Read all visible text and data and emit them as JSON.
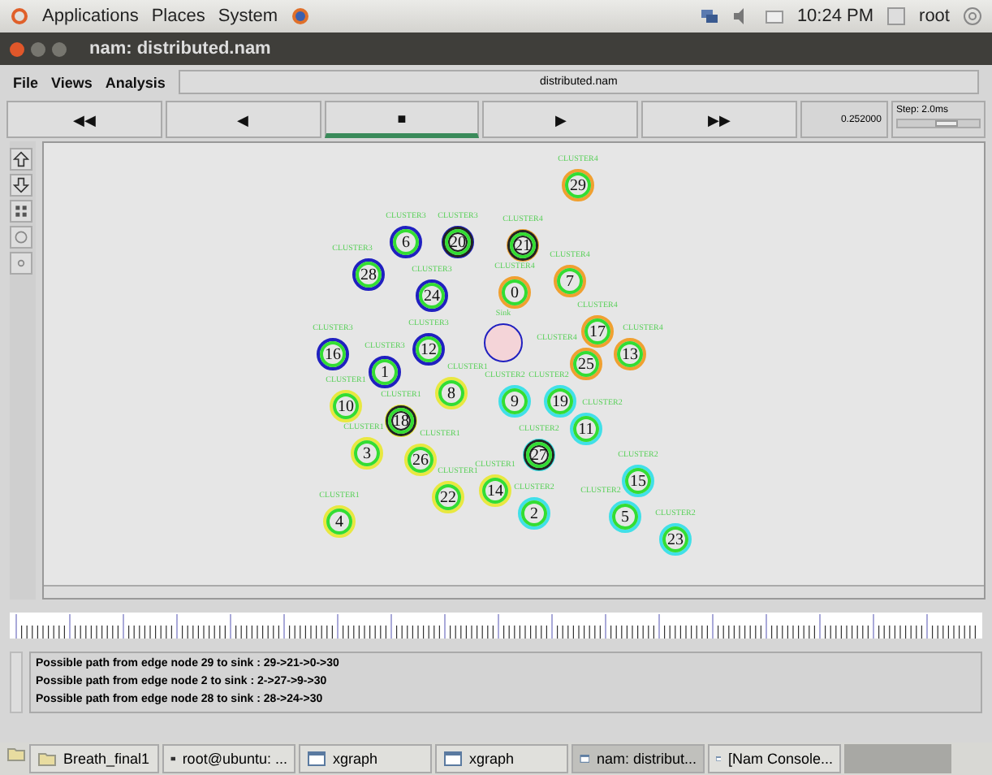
{
  "top_panel": {
    "menus": [
      "Applications",
      "Places",
      "System"
    ],
    "clock": "10:24 PM",
    "user": "root"
  },
  "window": {
    "title": "nam: distributed.nam"
  },
  "menu_bar": {
    "items": [
      "File",
      "Views",
      "Analysis"
    ],
    "file_name": "distributed.nam"
  },
  "controls": [
    {
      "glyph": "◀◀",
      "selected": false
    },
    {
      "glyph": "◀",
      "selected": false
    },
    {
      "glyph": "■",
      "selected": true
    },
    {
      "glyph": "▶",
      "selected": false
    },
    {
      "glyph": "▶▶",
      "selected": false
    }
  ],
  "time": "0.252000",
  "step": {
    "label": "Step: 2.0ms",
    "level": 0.6
  },
  "nodes": [
    {
      "kind": "node",
      "number": "29",
      "label": "CLUSTER4",
      "color": "#f0a030",
      "highlighted": false
    },
    {
      "kind": "node",
      "number": "6",
      "label": "CLUSTER3",
      "color": "#2020c0",
      "highlighted": false
    },
    {
      "kind": "node",
      "number": "20",
      "label": "CLUSTER3",
      "color": "#2020c0",
      "highlighted": true
    },
    {
      "kind": "node",
      "number": "21",
      "label": "CLUSTER4",
      "color": "#f0a030",
      "highlighted": true
    },
    {
      "kind": "node",
      "number": "28",
      "label": "CLUSTER3",
      "color": "#2020c0",
      "highlighted": false
    },
    {
      "kind": "node",
      "number": "24",
      "label": "CLUSTER3",
      "color": "#2020c0",
      "highlighted": false
    },
    {
      "kind": "node",
      "number": "0",
      "label": "CLUSTER4",
      "color": "#f0a030",
      "highlighted": false
    },
    {
      "kind": "node",
      "number": "7",
      "label": "CLUSTER4",
      "color": "#f0a030",
      "highlighted": false
    },
    {
      "kind": "node",
      "number": "16",
      "label": "CLUSTER3",
      "color": "#2020c0",
      "highlighted": false
    },
    {
      "kind": "node",
      "number": "12",
      "label": "CLUSTER3",
      "color": "#2020c0",
      "highlighted": false
    },
    {
      "kind": "sink",
      "label": "Sink",
      "color": "#2020c0"
    },
    {
      "kind": "node",
      "number": "17",
      "label": "CLUSTER4",
      "color": "#f0a030",
      "highlighted": false
    },
    {
      "kind": "node",
      "number": "13",
      "label": "CLUSTER4",
      "color": "#f0a030",
      "highlighted": false
    },
    {
      "kind": "node",
      "number": "1",
      "label": "CLUSTER3",
      "color": "#2020c0",
      "highlighted": false
    },
    {
      "kind": "node",
      "number": "25",
      "label": "CLUSTER4",
      "color": "#f0a030",
      "highlighted": false
    },
    {
      "kind": "node",
      "number": "10",
      "label": "CLUSTER1",
      "color": "#e8e840",
      "highlighted": false
    },
    {
      "kind": "node",
      "number": "8",
      "label": "CLUSTER1",
      "color": "#e8e840",
      "highlighted": false
    },
    {
      "kind": "node",
      "number": "9",
      "label": "CLUSTER2",
      "color": "#40e0e8",
      "highlighted": false
    },
    {
      "kind": "node",
      "number": "19",
      "label": "CLUSTER2",
      "color": "#40e0e8",
      "highlighted": false
    },
    {
      "kind": "node",
      "number": "18",
      "label": "CLUSTER1",
      "color": "#e8e840",
      "highlighted": true
    },
    {
      "kind": "node",
      "number": "11",
      "label": "CLUSTER2",
      "color": "#40e0e8",
      "highlighted": false
    },
    {
      "kind": "node",
      "number": "3",
      "label": "CLUSTER1",
      "color": "#e8e840",
      "highlighted": false
    },
    {
      "kind": "node",
      "number": "26",
      "label": "CLUSTER1",
      "color": "#e8e840",
      "highlighted": false
    },
    {
      "kind": "node",
      "number": "27",
      "label": "CLUSTER2",
      "color": "#40e0e8",
      "highlighted": true
    },
    {
      "kind": "node",
      "number": "22",
      "label": "CLUSTER1",
      "color": "#e8e840",
      "highlighted": false
    },
    {
      "kind": "node",
      "number": "14",
      "label": "CLUSTER1",
      "color": "#e8e840",
      "highlighted": false
    },
    {
      "kind": "node",
      "number": "15",
      "label": "CLUSTER2",
      "color": "#40e0e8",
      "highlighted": false
    },
    {
      "kind": "node",
      "number": "4",
      "label": "CLUSTER1",
      "color": "#e8e840",
      "highlighted": false
    },
    {
      "kind": "node",
      "number": "2",
      "label": "CLUSTER2",
      "color": "#40e0e8",
      "highlighted": false
    },
    {
      "kind": "node",
      "number": "5",
      "label": "CLUSTER2",
      "color": "#40e0e8",
      "highlighted": false
    },
    {
      "kind": "node",
      "number": "23",
      "label": "CLUSTER2",
      "color": "#40e0e8",
      "highlighted": false
    }
  ],
  "annotations": [
    "Possible path from edge node 29 to sink : 29->21->0->30",
    "Possible path from edge node 2 to sink : 2->27->9->30",
    "Possible path from edge node 28 to sink : 28->24->30"
  ],
  "taskbar": [
    {
      "label": "Breath_final1",
      "kind": "folder",
      "selected": false
    },
    {
      "label": "root@ubuntu: ...",
      "kind": "terminal",
      "selected": false
    },
    {
      "label": "xgraph",
      "kind": "window",
      "selected": false
    },
    {
      "label": "xgraph",
      "kind": "window",
      "selected": false
    },
    {
      "label": "nam: distribut...",
      "kind": "window",
      "selected": true
    },
    {
      "label": "[Nam Console...",
      "kind": "window",
      "selected": false
    }
  ]
}
